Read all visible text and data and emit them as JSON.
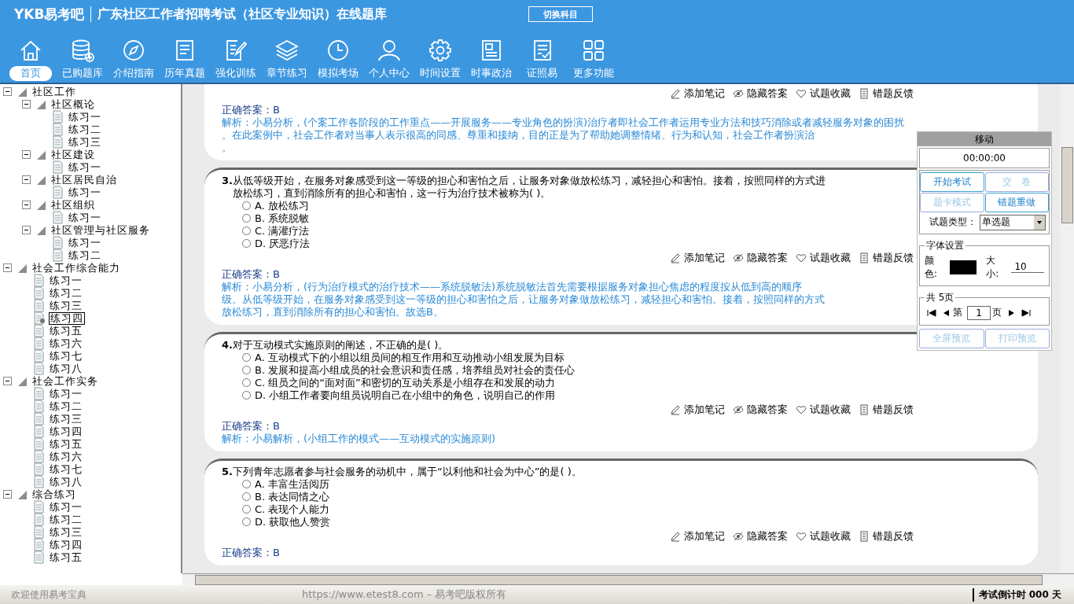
{
  "window": {
    "brand": "YKB易考吧",
    "title": "广东社区工作者招聘考试（社区专业知识）在线题库",
    "switch_button": "切换科目"
  },
  "nav": [
    {
      "label": "首页",
      "selected": true
    },
    {
      "label": "已购题库",
      "selected": false
    },
    {
      "label": "介绍指南",
      "selected": false
    },
    {
      "label": "历年真题",
      "selected": false
    },
    {
      "label": "强化训练",
      "selected": false
    },
    {
      "label": "章节练习",
      "selected": false
    },
    {
      "label": "模拟考场",
      "selected": false
    },
    {
      "label": "个人中心",
      "selected": false
    },
    {
      "label": "时间设置",
      "selected": false
    },
    {
      "label": "时事政治",
      "selected": false
    },
    {
      "label": "证照易",
      "selected": false
    },
    {
      "label": "更多功能",
      "selected": false
    }
  ],
  "tree": [
    {
      "label": "社区工作",
      "expanded": true,
      "selected": false,
      "children": [
        {
          "label": "社区概论",
          "expanded": true,
          "selected": false,
          "children": [
            {
              "label": "练习一",
              "selected": false
            },
            {
              "label": "练习二",
              "selected": false
            },
            {
              "label": "练习三",
              "selected": false
            }
          ]
        },
        {
          "label": "社区建设",
          "expanded": true,
          "selected": false,
          "children": [
            {
              "label": "练习一",
              "selected": false
            }
          ]
        },
        {
          "label": "社区居民自治",
          "expanded": true,
          "selected": false,
          "children": [
            {
              "label": "练习一",
              "selected": false
            }
          ]
        },
        {
          "label": "社区组织",
          "expanded": true,
          "selected": false,
          "children": [
            {
              "label": "练习一",
              "selected": false
            }
          ]
        },
        {
          "label": "社区管理与社区服务",
          "expanded": true,
          "selected": false,
          "children": [
            {
              "label": "练习一",
              "selected": false
            },
            {
              "label": "练习二",
              "selected": false
            }
          ]
        }
      ]
    },
    {
      "label": "社会工作综合能力",
      "expanded": true,
      "selected": false,
      "children": [
        {
          "label": "练习一",
          "selected": false
        },
        {
          "label": "练习二",
          "selected": false
        },
        {
          "label": "练习三",
          "selected": false
        },
        {
          "label": "练习四",
          "selected": true
        },
        {
          "label": "练习五",
          "selected": false
        },
        {
          "label": "练习六",
          "selected": false
        },
        {
          "label": "练习七",
          "selected": false
        },
        {
          "label": "练习八",
          "selected": false
        }
      ]
    },
    {
      "label": "社会工作实务",
      "expanded": true,
      "selected": false,
      "children": [
        {
          "label": "练习一",
          "selected": false
        },
        {
          "label": "练习二",
          "selected": false
        },
        {
          "label": "练习三",
          "selected": false
        },
        {
          "label": "练习四",
          "selected": false
        },
        {
          "label": "练习五",
          "selected": false
        },
        {
          "label": "练习六",
          "selected": false
        },
        {
          "label": "练习七",
          "selected": false
        },
        {
          "label": "练习八",
          "selected": false
        }
      ]
    },
    {
      "label": "综合练习",
      "expanded": true,
      "selected": false,
      "children": [
        {
          "label": "练习一",
          "selected": false
        },
        {
          "label": "练习二",
          "selected": false
        },
        {
          "label": "练习三",
          "selected": false
        },
        {
          "label": "练习四",
          "selected": false
        },
        {
          "label": "练习五",
          "selected": false
        }
      ]
    }
  ],
  "questions": [
    {
      "actions": [
        "添加笔记",
        "隐藏答案",
        "试题收藏",
        "错题反馈"
      ],
      "answer": "正确答案：B",
      "analysis": [
        "解析：小易分析，(个案工作各阶段的工作重点——开展服务——专业角色的扮演)治疗者即社会工作者运用专业方法和技巧消除或者减轻服务对象的困扰",
        "。在此案例中，社会工作者对当事人表示很高的同感、尊重和接纳，目的正是为了帮助她调整情绪、行为和认知，社会工作者扮演治",
        "。"
      ]
    },
    {
      "number": "3.",
      "question": [
        "从低等级开始，在服务对象感受到这一等级的担心和害怕之后，让服务对象做放松练习，减轻担心和害怕。接着，按照同样的方式进",
        "放松练习，直到消除所有的担心和害怕，这一行为治疗技术被称为( )。"
      ],
      "options": [
        {
          "text": "A. 放松练习",
          "checked": false
        },
        {
          "text": "B. 系统脱敏",
          "checked": false
        },
        {
          "text": "C. 满灌疗法",
          "checked": false
        },
        {
          "text": "D. 厌恶疗法",
          "checked": false
        }
      ],
      "actions": [
        "添加笔记",
        "隐藏答案",
        "试题收藏",
        "错题反馈"
      ],
      "answer": "正确答案：B",
      "analysis": [
        "解析：小易分析，(行为治疗模式的治疗技术——系统脱敏法)系统脱敏法首先需要根据服务对象担心焦虑的程度按从低到高的顺序",
        "级。从低等级开始，在服务对象感受到这一等级的担心和害怕之后，让服务对象做放松练习，减轻担心和害怕。接着，按照同样的方式",
        "放松练习，直到消除所有的担心和害怕。故选B。"
      ]
    },
    {
      "number": "4.",
      "question": [
        "对于互动模式实施原则的阐述，不正确的是( )。"
      ],
      "options": [
        {
          "text": "A. 互动模式下的小组以组员间的相互作用和互动推动小组发展为目标",
          "checked": false
        },
        {
          "text": "B. 发展和提高小组成员的社会意识和责任感，培养组员对社会的责任心",
          "checked": false
        },
        {
          "text": "C. 组员之间的“面对面”和密切的互动关系是小组存在和发展的动力",
          "checked": false
        },
        {
          "text": "D. 小组工作者要向组员说明自己在小组中的角色，说明自己的作用",
          "checked": false
        }
      ],
      "actions": [
        "添加笔记",
        "隐藏答案",
        "试题收藏",
        "错题反馈"
      ],
      "answer": "正确答案：B",
      "analysis": [
        "解析：小易解析，(小组工作的模式——互动模式的实施原则)"
      ]
    },
    {
      "number": "5.",
      "question": [
        "下列青年志愿者参与社会服务的动机中，属于“以利他和社会为中心”的是( )。"
      ],
      "options": [
        {
          "text": "A. 丰富生活阅历",
          "checked": false
        },
        {
          "text": "B. 表达同情之心",
          "checked": false
        },
        {
          "text": "C. 表现个人能力",
          "checked": false
        },
        {
          "text": "D. 获取他人赞赏",
          "checked": false
        }
      ],
      "actions": [
        "添加笔记",
        "隐藏答案",
        "试题收藏",
        "错题反馈"
      ],
      "answer": "正确答案：B"
    }
  ],
  "panel": {
    "title": "移动",
    "timer": "00:00:00",
    "buttons": [
      {
        "label": "开始考试",
        "disabled": false
      },
      {
        "label": "交　卷",
        "disabled": true
      },
      {
        "label": "题卡模式",
        "disabled": true
      },
      {
        "label": "错题重做",
        "disabled": false
      }
    ],
    "type_label": "试题类型：",
    "type_value": "单选题",
    "font_legend": "字体设置",
    "color_label": "颜色:",
    "size_label": "大小:",
    "size_value": "10",
    "pages_legend": "共 5页",
    "page_prefix": "第",
    "page_value": "1",
    "page_suffix": "页",
    "bottom_buttons": [
      {
        "label": "全屏预览",
        "disabled": true
      },
      {
        "label": "打印预览",
        "disabled": true
      }
    ]
  },
  "status_bar": {
    "welcome": "欢迎使用易考宝典",
    "copyright": "https://www.etest8.com – 易考吧版权所有",
    "countdown": "考试倒计时 000 天"
  }
}
